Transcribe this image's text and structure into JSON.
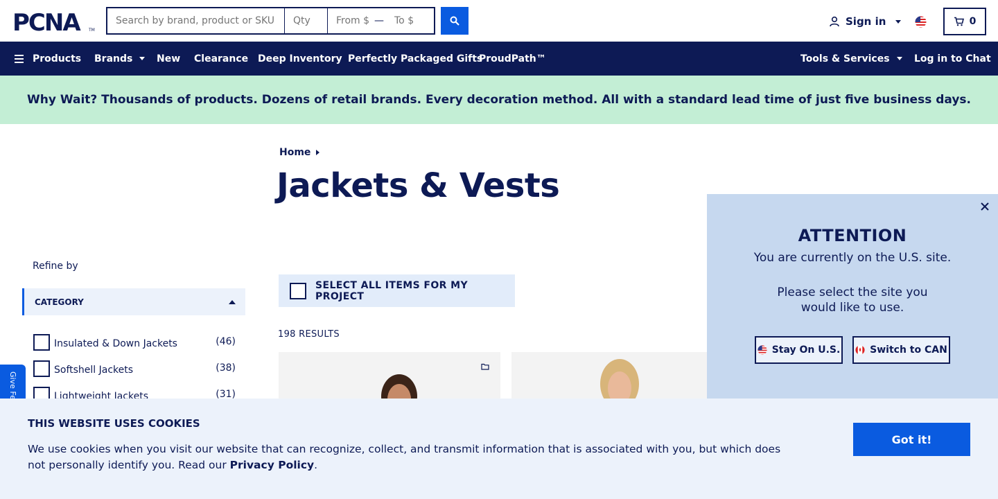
{
  "header": {
    "logo_text": "PCNA",
    "search": {
      "main_placeholder": "Search by brand, product or SKU",
      "qty_placeholder": "Qty",
      "from_placeholder": "From $",
      "dash": "—",
      "to_placeholder": "To $"
    },
    "signin_label": "Sign in",
    "cart_count": "0"
  },
  "nav": {
    "products": "Products",
    "brands": "Brands",
    "new": "New",
    "clearance": "Clearance",
    "deep_inventory": "Deep Inventory",
    "gifts": "Perfectly Packaged Gifts",
    "proudpath": "ProudPath™",
    "tools": "Tools & Services",
    "chat": "Log in to Chat"
  },
  "banner": {
    "text": "Why Wait? Thousands of products. Dozens of retail brands. Every decoration method. All with a standard lead time of just five business days."
  },
  "breadcrumb": {
    "home": "Home"
  },
  "page_title": "Jackets & Vests",
  "sidebar": {
    "refine_label": "Refine by",
    "category_label": "CATEGORY",
    "filters": [
      {
        "label": "Insulated & Down Jackets",
        "count": "(46)"
      },
      {
        "label": "Softshell Jackets",
        "count": "(38)"
      },
      {
        "label": "Lightweight Jackets",
        "count": "(31)"
      }
    ]
  },
  "results": {
    "select_all_label": "SELECT ALL ITEMS FOR MY PROJECT",
    "count_label": "198 RESULTS"
  },
  "feedback_label": "Give Feedback",
  "attention": {
    "title": "ATTENTION",
    "line1": "You are currently on the U.S. site.",
    "line2": "Please select the site you would like to use.",
    "stay_label": "Stay On U.S.",
    "switch_label": "Switch to CAN"
  },
  "cookie": {
    "title": "THIS WEBSITE USES COOKIES",
    "text": "We use cookies when you visit our website that can recognize, collect, and transmit information that is associated with you, but which does not personally identify you. Read our ",
    "link": "Privacy Policy",
    "period": ".",
    "button": "Got it!"
  },
  "colors": {
    "navy": "#0d1a55",
    "accent_blue": "#0a5be0",
    "banner_green": "#c3eed5",
    "modal_bg": "#c6d8ef",
    "cookie_bg": "#ecf2fb"
  },
  "icons": [
    "search-icon",
    "user-icon",
    "us-flag-icon",
    "cart-icon",
    "hamburger-icon",
    "folder-icon",
    "close-icon",
    "canada-flag-icon"
  ]
}
